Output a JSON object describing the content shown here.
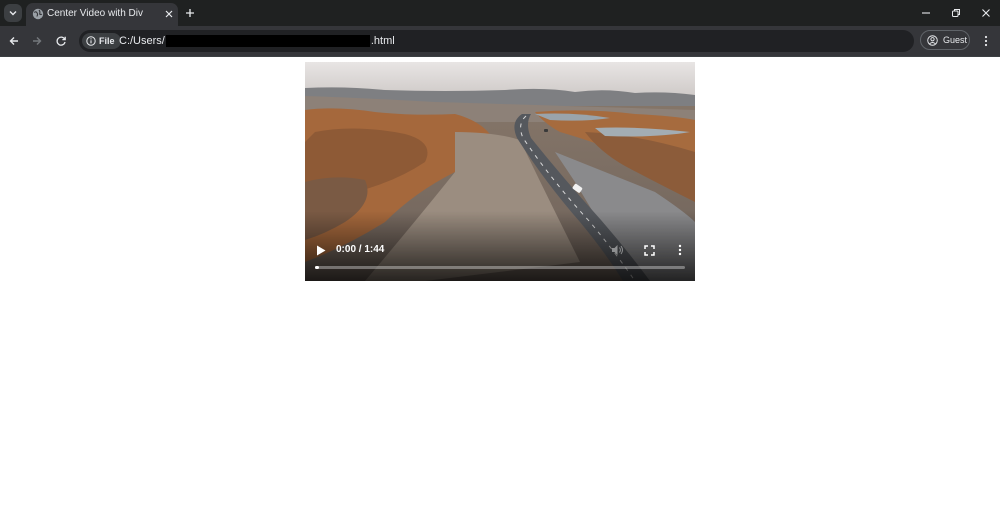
{
  "browser": {
    "tab": {
      "title": "Center Video with Div",
      "favicon": "globe-icon"
    },
    "toolbar": {
      "security_chip": "File",
      "url_prefix": "C:/Users/",
      "url_suffix": ".html"
    },
    "profile": {
      "label": "Guest",
      "icon": "person-circle-icon"
    }
  },
  "video": {
    "current_time": "0:00",
    "duration": "1:44",
    "time_display": "0:00 / 1:44",
    "progress_fraction": 0.01,
    "colors": {
      "sky": "#dcd9d8",
      "terrain_orange": "#b06a3a",
      "road": "#5a5d62"
    }
  }
}
